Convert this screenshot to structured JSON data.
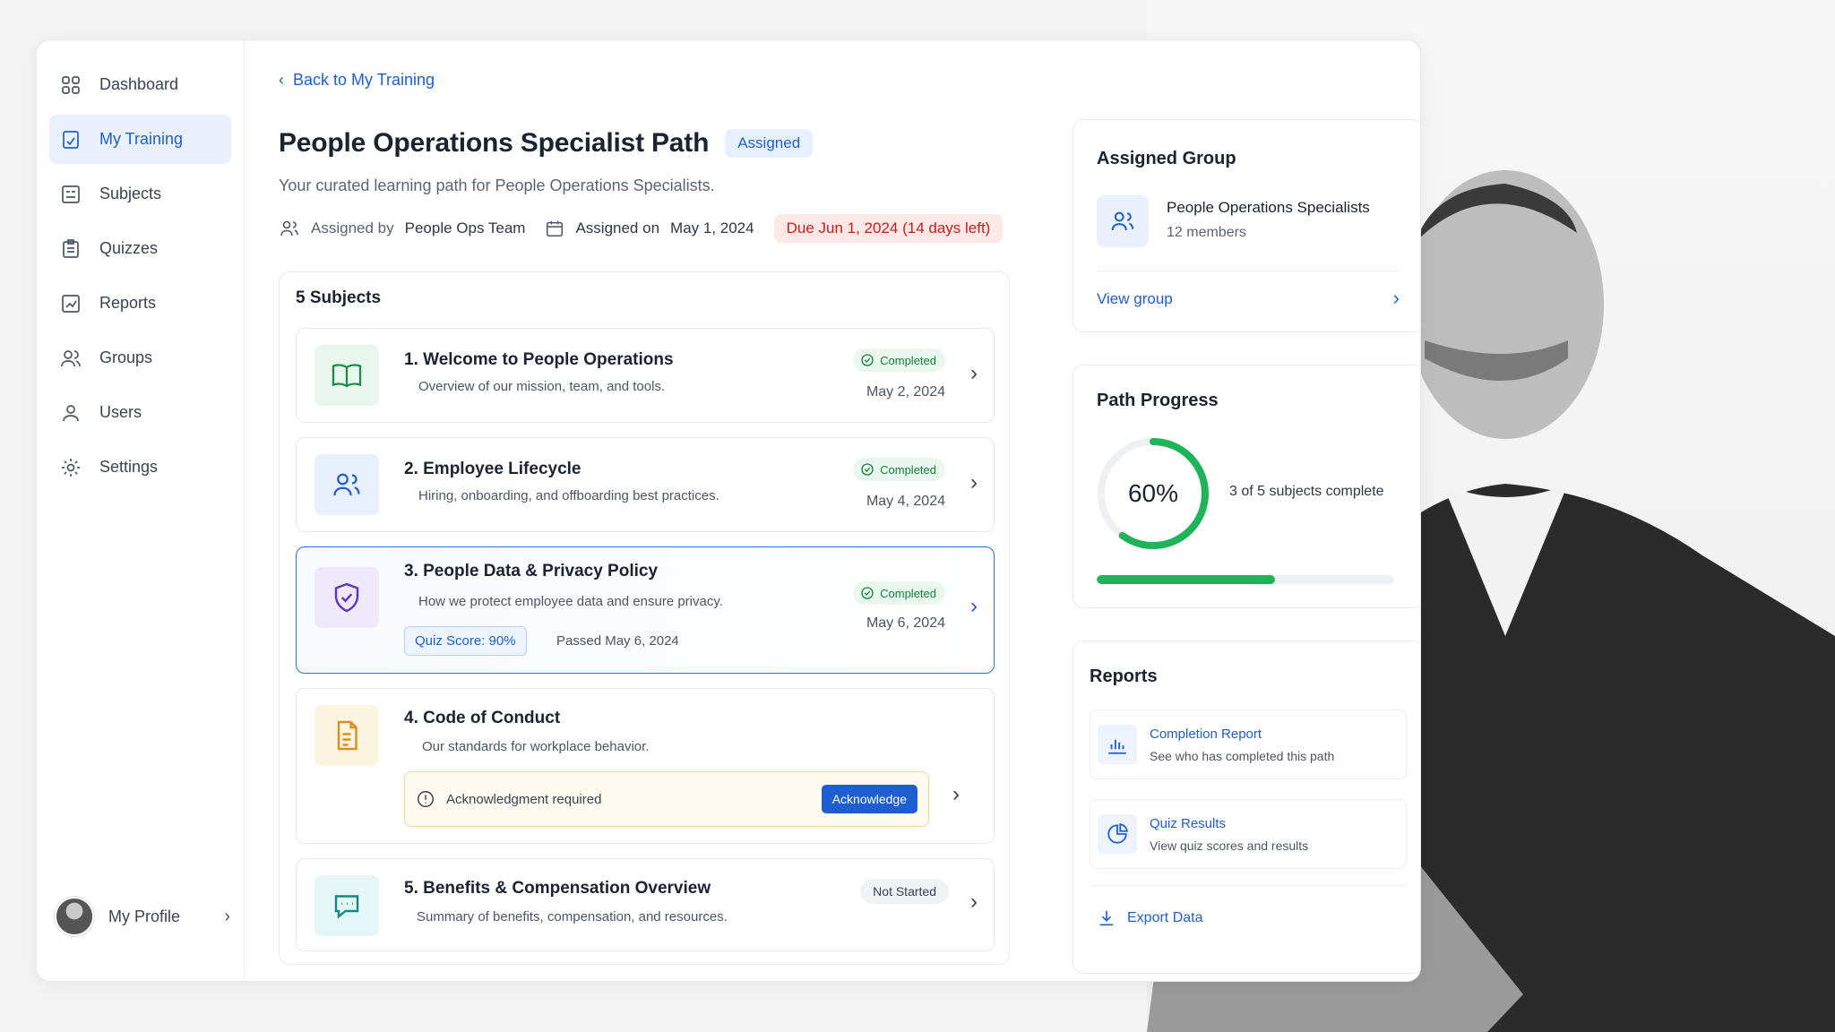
{
  "colors": {
    "accent": "#1d5fd0",
    "success": "#15803d",
    "danger": "#c81e1e",
    "progress_fill": "#1fb45a",
    "warning_border": "#f3d48a"
  },
  "sidebar": {
    "items": [
      {
        "label": "Dashboard",
        "icon": "grid-icon"
      },
      {
        "label": "My Training",
        "icon": "training-icon"
      },
      {
        "label": "Subjects",
        "icon": "subjects-icon"
      },
      {
        "label": "Quizzes",
        "icon": "quiz-icon"
      },
      {
        "label": "Reports",
        "icon": "chart-icon"
      },
      {
        "label": "Groups",
        "icon": "groups-icon"
      },
      {
        "label": "Users",
        "icon": "user-icon"
      },
      {
        "label": "Settings",
        "icon": "gear-icon"
      }
    ],
    "active_index": 1,
    "profile_label": "My Profile"
  },
  "main": {
    "back_label": "Back to My Training",
    "title": "People Operations Specialist Path",
    "status_badge": "Assigned",
    "subtitle": "Your curated learning path for People Operations Specialists.",
    "assigned_by_prefix": "Assigned by",
    "assigned_by": "People Ops Team",
    "assigned_on_prefix": "Assigned on",
    "assigned_on": "May 1, 2024",
    "due": "Due Jun 1, 2024 (14 days left)",
    "subjects_count": "5 Subjects",
    "subjects": [
      {
        "title": "1. Welcome to People Operations",
        "desc": "Overview of our mission, team, and tools.",
        "status": "Completed",
        "date": "May 2, 2024",
        "icon": "book-icon"
      },
      {
        "title": "2. Employee Lifecycle",
        "desc": "Hiring, onboarding, and offboarding best practices.",
        "status": "Completed",
        "date": "May 4, 2024",
        "icon": "people-icon"
      },
      {
        "title": "3. People Data & Privacy Policy",
        "desc": "How we protect employee data and ensure privacy.",
        "status": "Completed",
        "date": "May 6, 2024",
        "icon": "shield-icon",
        "quiz_score": "Quiz Score: 90%",
        "passed": "Passed May 6, 2024"
      },
      {
        "title": "4. Code of Conduct",
        "desc": "Our standards for workplace behavior.",
        "icon": "document-icon",
        "ack_text": "Acknowledgment required",
        "ack_button": "Acknowledge"
      },
      {
        "title": "5. Benefits & Compensation Overview",
        "desc": "Summary of benefits, compensation, and resources.",
        "status": "Not Started",
        "icon": "chat-icon"
      }
    ]
  },
  "right": {
    "group": {
      "title": "Assigned Group",
      "name": "People Operations Specialists",
      "members": "12 members",
      "view_label": "View group"
    },
    "progress": {
      "title": "Path Progress",
      "percent_label": "60%",
      "percent": 0.6,
      "summary": "3 of 5 subjects complete"
    },
    "reports": {
      "title": "Reports",
      "items": [
        {
          "title": "Completion Report",
          "desc": "See who has completed this path"
        },
        {
          "title": "Quiz Results",
          "desc": "View quiz scores and results"
        }
      ],
      "export_label": "Export Data"
    }
  }
}
